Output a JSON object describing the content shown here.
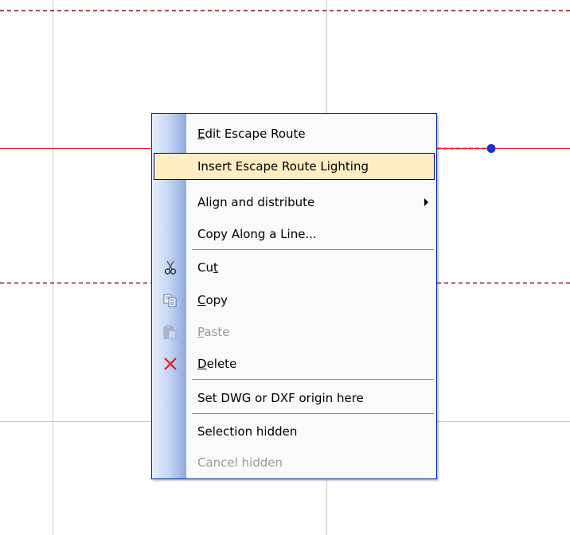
{
  "colors": {
    "menu_border": "#002d96",
    "highlight_bg": "#ffeec2",
    "highlight_border": "#000080",
    "separator": "#6a8ccb",
    "escape_line": "#e8202a",
    "escape_point": "#1a2fd8",
    "grid_line": "#c8c8c8",
    "dashed_boundary": "#7a1a1a",
    "disabled_text": "#9a9a9a"
  },
  "context_menu": {
    "items": [
      {
        "label": "Edit Escape Route",
        "mnemonic": "E",
        "icon": null,
        "state": "normal"
      },
      {
        "label": "Insert Escape Route Lighting",
        "icon": null,
        "state": "highlighted"
      },
      {
        "label": "Align and distribute",
        "icon": null,
        "state": "normal",
        "has_submenu": true
      },
      {
        "label": "Copy Along a Line...",
        "icon": null,
        "state": "normal"
      },
      {
        "label": "Cut",
        "mnemonic": "t",
        "icon": "scissors-icon",
        "state": "normal"
      },
      {
        "label": "Copy",
        "mnemonic": "C",
        "icon": "copy-icon",
        "state": "normal"
      },
      {
        "label": "Paste",
        "mnemonic": "P",
        "icon": "paste-icon",
        "state": "disabled"
      },
      {
        "label": "Delete",
        "mnemonic": "D",
        "icon": "delete-x-icon",
        "state": "normal"
      },
      {
        "label": "Set DWG or DXF origin here",
        "icon": null,
        "state": "normal"
      },
      {
        "label": "Selection hidden",
        "icon": null,
        "state": "normal"
      },
      {
        "label": "Cancel hidden",
        "icon": null,
        "state": "disabled"
      }
    ]
  }
}
